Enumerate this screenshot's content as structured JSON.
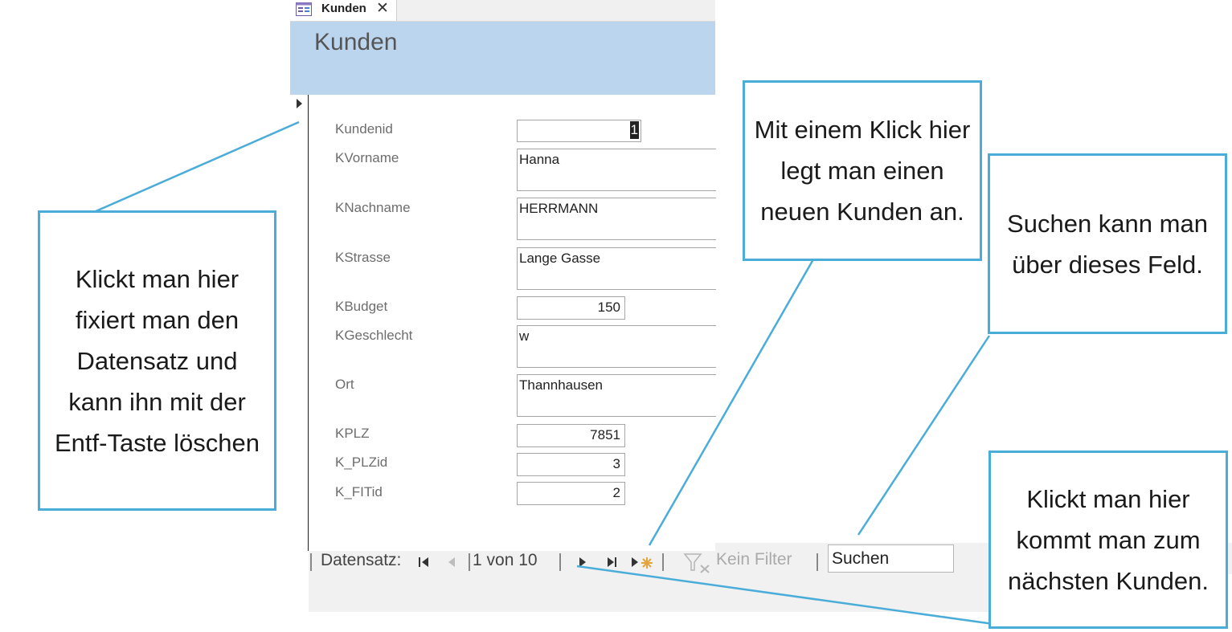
{
  "tab": {
    "label": "Kunden",
    "form_icon": "form-icon",
    "close_glyph": "✕"
  },
  "form": {
    "title": "Kunden"
  },
  "fields": [
    {
      "label": "Kundenid",
      "value": "1"
    },
    {
      "label": "KVorname",
      "value": "Hanna"
    },
    {
      "label": "KNachname",
      "value": "HERRMANN"
    },
    {
      "label": "KStrasse",
      "value": "Lange Gasse"
    },
    {
      "label": "KBudget",
      "value": "150"
    },
    {
      "label": "KGeschlecht",
      "value": "w"
    },
    {
      "label": "Ort",
      "value": "Thannhausen"
    },
    {
      "label": "KPLZ",
      "value": "7851"
    },
    {
      "label": "K_PLZid",
      "value": "3"
    },
    {
      "label": "K_FITid",
      "value": "2"
    }
  ],
  "navigation": {
    "label": "Datensatz:",
    "counter": "1 von 10",
    "filter_label": "Kein Filter",
    "search_value": "Suchen",
    "icons": [
      "first-record-icon",
      "previous-record-icon",
      "next-record-icon",
      "last-record-icon",
      "new-record-icon",
      "filter-icon"
    ]
  },
  "callouts": {
    "selector": "Klickt man hier fixiert man den Datensatz und kann ihn mit der Entf-Taste löschen",
    "new_record": "Mit einem Klick hier legt man einen neuen Kunden an.",
    "search": "Suchen kann man über dieses Feld.",
    "next_record": "Klickt man hier kommt man zum nächsten Kunden."
  },
  "colors": {
    "header_band": "#bcd5ef",
    "callout_border": "#4aadd9",
    "navbar": "#f1f1f1"
  }
}
